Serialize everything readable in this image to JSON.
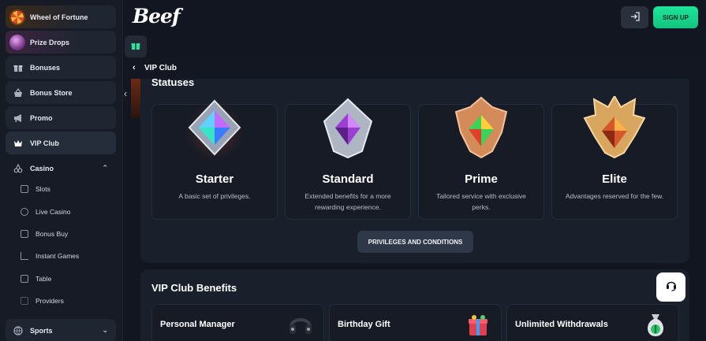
{
  "sidebar": {
    "featured": [
      {
        "label": "Wheel of Fortune",
        "icon": "wheel-of-fortune-icon"
      },
      {
        "label": "Prize Drops",
        "icon": "prize-drops-icon"
      }
    ],
    "items": [
      {
        "label": "Bonuses",
        "icon": "gift-icon"
      },
      {
        "label": "Bonus Store",
        "icon": "basket-icon"
      },
      {
        "label": "Promo",
        "icon": "megaphone-icon"
      },
      {
        "label": "VIP Club",
        "icon": "crown-icon",
        "active": true
      },
      {
        "label": "Casino",
        "icon": "cherry-icon",
        "expanded": true
      }
    ],
    "casino_sub": [
      {
        "label": "Slots",
        "icon": "slots-icon"
      },
      {
        "label": "Live Casino",
        "icon": "live-casino-icon"
      },
      {
        "label": "Bonus Buy",
        "icon": "bonus-buy-icon"
      },
      {
        "label": "Instant Games",
        "icon": "instant-games-icon"
      },
      {
        "label": "Table",
        "icon": "table-icon"
      },
      {
        "label": "Providers",
        "icon": "providers-icon"
      }
    ],
    "sports": {
      "label": "Sports",
      "icon": "sports-ball-icon"
    }
  },
  "header": {
    "logo": "Beef",
    "signup_label": "SIGN UP"
  },
  "breadcrumb": {
    "title": "VIP Club"
  },
  "statuses": {
    "title": "Statuses",
    "cards": [
      {
        "name": "Starter",
        "desc": "A basic set of privileges."
      },
      {
        "name": "Standard",
        "desc": "Extended benefits for a more rewarding experience."
      },
      {
        "name": "Prime",
        "desc": "Tailored service with exclusive perks."
      },
      {
        "name": "Elite",
        "desc": "Advantages reserved for the few."
      }
    ],
    "button_label": "PRIVILEGES AND CONDITIONS"
  },
  "benefits": {
    "title": "VIP Club Benefits",
    "cards": [
      {
        "label": "Personal Manager",
        "icon": "headset-icon"
      },
      {
        "label": "Birthday Gift",
        "icon": "gift-box-icon"
      },
      {
        "label": "Unlimited Withdrawals",
        "icon": "money-bag-icon"
      }
    ]
  },
  "colors": {
    "accent_green": "#1ee59a",
    "background": "#111620",
    "card": "#161b25"
  }
}
